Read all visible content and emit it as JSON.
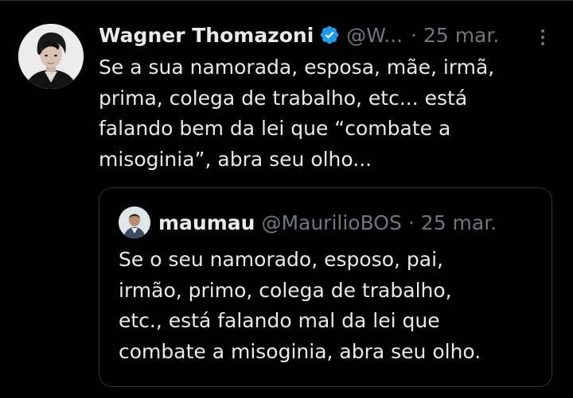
{
  "tweet": {
    "author_name": "Wagner Thomazoni",
    "handle": "@W...",
    "separator": "·",
    "date": "25 mar.",
    "text": "Se a sua namorada, esposa, mãe, irmã,\nprima, colega de trabalho, etc... está\nfalando bem da lei que “combate a\nmisoginia”, abra seu olho...",
    "verified_icon": "verified-badge-icon",
    "more_icon": "more-options-icon"
  },
  "quote": {
    "author_name": "maumau",
    "handle": "@MaurilioBOS",
    "separator": "·",
    "date": "25 mar.",
    "text": "Se o seu namorado, esposo, pai,\nirmão, primo, colega de trabalho,\netc., está falando mal da lei que\ncombate a misoginia, abra seu olho."
  },
  "colors": {
    "background": "#000000",
    "text_primary": "#e7e9ea",
    "text_secondary": "#71767b",
    "border": "#2f3336",
    "verified_blue": "#1d9bf0"
  }
}
